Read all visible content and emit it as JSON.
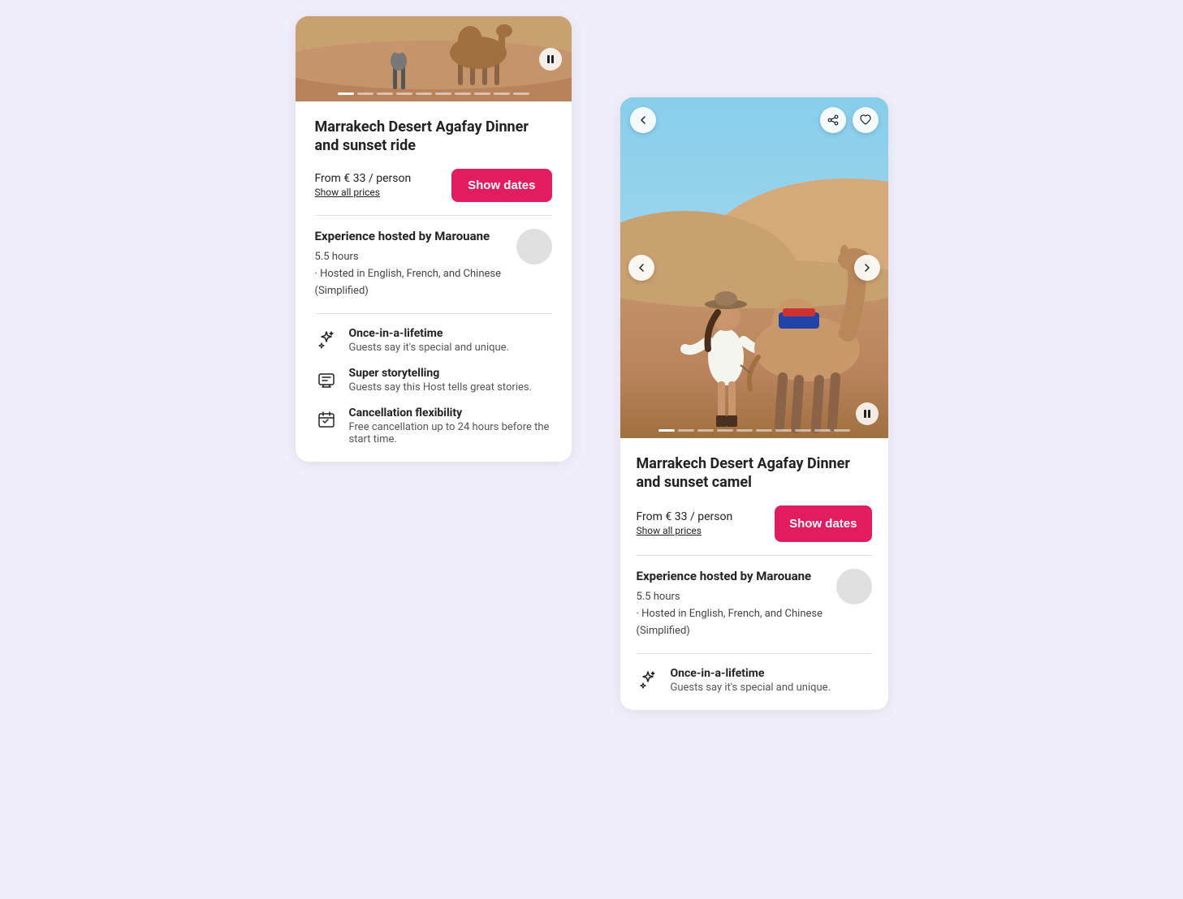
{
  "left_card": {
    "title": "Marrakech Desert Agafay Dinner and sunset ride",
    "price": "From € 33 / person",
    "show_all_prices": "Show all prices",
    "show_dates_btn": "Show dates",
    "host_title": "Experience hosted by Marouane",
    "duration": "5.5 hours",
    "languages": "· Hosted in English, French, and Chinese (Simplified)",
    "features": [
      {
        "icon": "sparkle-icon",
        "title": "Once-in-a-lifetime",
        "desc": "Guests say it's special and unique."
      },
      {
        "icon": "storytelling-icon",
        "title": "Super storytelling",
        "desc": "Guests say this Host tells great stories."
      },
      {
        "icon": "calendar-icon",
        "title": "Cancellation flexibility",
        "desc": "Free cancellation up to 24 hours before the start time."
      }
    ]
  },
  "right_card": {
    "title": "Marrakech Desert Agafay Dinner and sunset camel",
    "price": "From € 33 / person",
    "show_all_prices": "Show all prices",
    "show_dates_btn": "Show dates",
    "host_title": "Experience hosted by Marouane",
    "duration": "5.5 hours",
    "languages": "· Hosted in English, French, and Chinese (Simplified)",
    "features": [
      {
        "icon": "sparkle-icon",
        "title": "Once-in-a-lifetime",
        "desc": "Guests say it's special and unique."
      }
    ]
  },
  "colors": {
    "accent": "#e31c5f",
    "bg": "#f0eef8"
  }
}
